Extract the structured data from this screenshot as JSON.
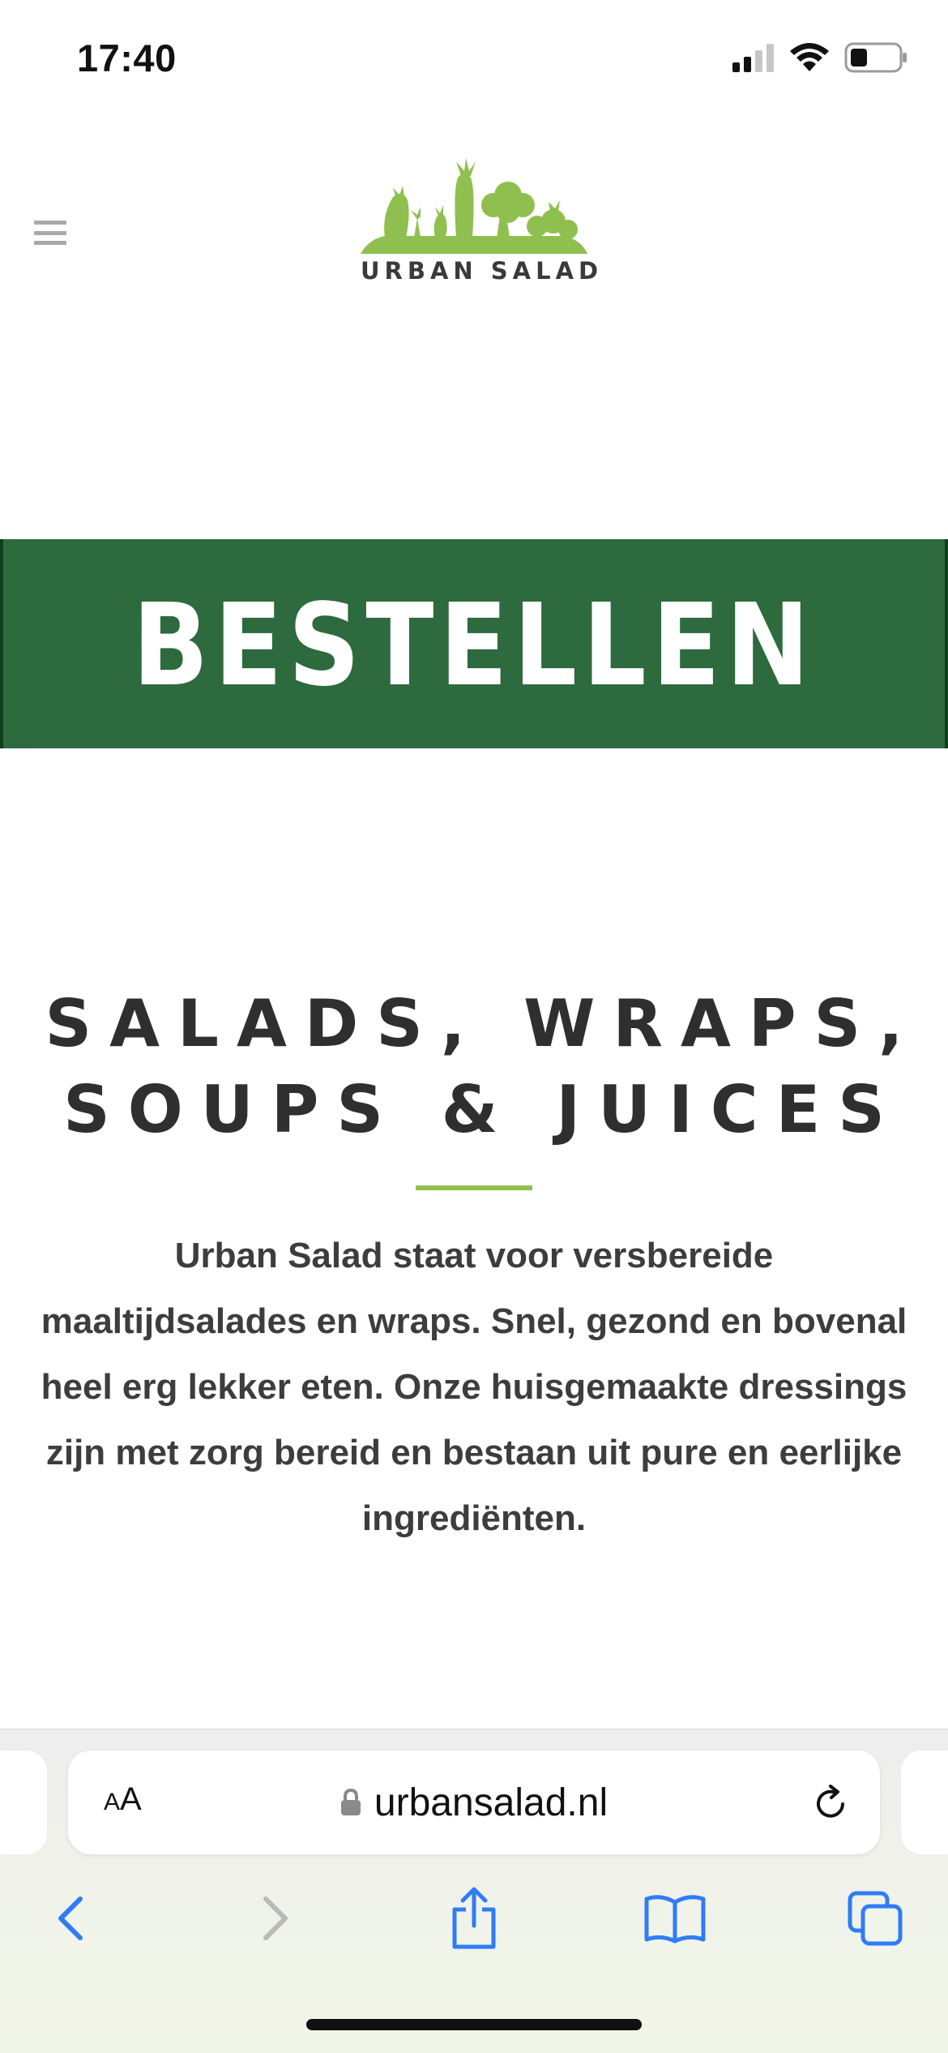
{
  "status_bar": {
    "time": "17:40",
    "icons": [
      "cellular-signal-icon",
      "wifi-icon",
      "battery-icon"
    ]
  },
  "site": {
    "logo_text": "URBAN SALAD",
    "menu_icon": "hamburger-menu-icon"
  },
  "order_banner": {
    "label": "BESTELLEN"
  },
  "hero": {
    "title_line1": "SALADS, WRAPS,",
    "title_line2": "SOUPS & JUICES",
    "intro_line1": "Urban Salad staat voor versbereide",
    "intro_line2": "maaltijdsalades en wraps. Snel, gezond en bovenal",
    "intro_line3": "heel erg lekker eten. Onze huisgemaakte dressings",
    "intro_line4": "zijn met zorg bereid en bestaan uit pure en eerlijke",
    "intro_line5": "ingrediënten."
  },
  "browser": {
    "text_size_small": "A",
    "text_size_large": "A",
    "url": "urbansalad.nl",
    "toolbar": [
      "back-icon",
      "forward-icon",
      "share-icon",
      "bookmarks-icon",
      "tabs-icon"
    ]
  },
  "colors": {
    "brand_green": "#8fc04f",
    "banner_green": "#2d6a3e",
    "heading_text": "#2f2f2f",
    "safari_blue": "#2f7cf6"
  }
}
